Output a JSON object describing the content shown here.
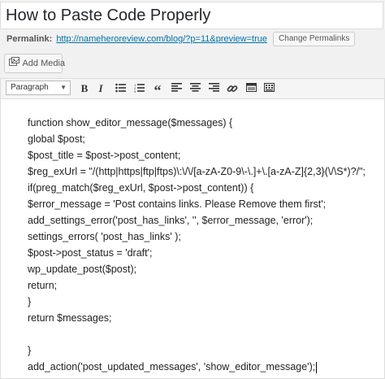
{
  "post": {
    "title": "How to Paste Code Properly",
    "permalink_label": "Permalink:",
    "permalink_url": "http://nameheroreview.com/blog/?p=11&preview=true",
    "change_permalinks_label": "Change Permalinks"
  },
  "media": {
    "add_media_label": "Add Media"
  },
  "toolbar": {
    "format_value": "Paragraph",
    "buttons": [
      "bold-icon",
      "italic-icon",
      "bulleted-list-icon",
      "numbered-list-icon",
      "blockquote-icon",
      "align-left-icon",
      "align-center-icon",
      "align-right-icon",
      "link-icon",
      "toolbar-toggle-icon",
      "kitchen-sink-icon"
    ]
  },
  "code_lines": [
    "function show_editor_message($messages) {",
    "global $post;",
    "$post_title = $post->post_content;",
    "$reg_exUrl = \"/(http|https|ftp|ftps)\\:\\/\\/[a-zA-Z0-9\\-\\.]+\\.[a-zA-Z]{2,3}(\\/\\S*)?/\";",
    "if(preg_match($reg_exUrl, $post->post_content)) {",
    "$error_message = 'Post contains links. Please Remove them first';",
    "add_settings_error('post_has_links', '', $error_message, 'error');",
    "settings_errors( 'post_has_links' );",
    "$post->post_status = 'draft';",
    "wp_update_post($post);",
    "return;",
    "}",
    "return $messages;",
    "",
    "}",
    "add_action('post_updated_messages', 'show_editor_message');"
  ]
}
